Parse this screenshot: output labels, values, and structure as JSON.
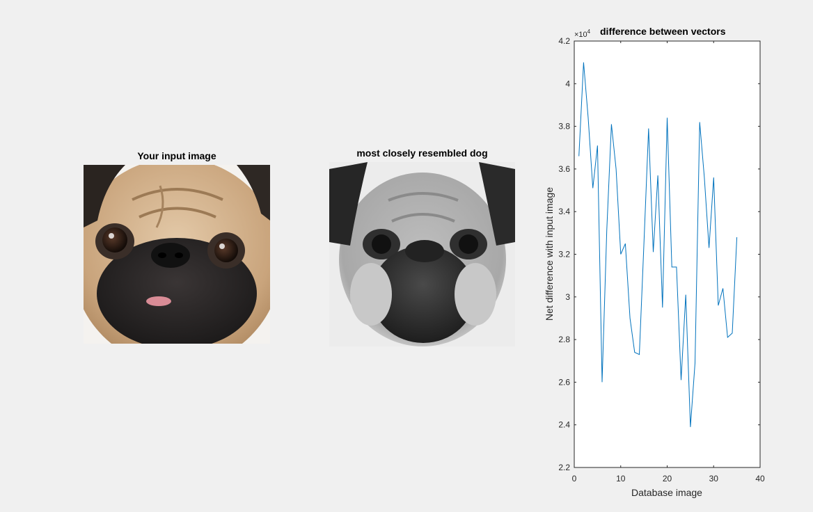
{
  "panels": {
    "input_title": "Your input image",
    "match_title": "most closely resembled dog"
  },
  "chart_data": {
    "type": "line",
    "title": "difference between vectors",
    "xlabel": "Database image",
    "ylabel": "Net difference with input image",
    "exponent_prefix": "×10",
    "exponent_power": "4",
    "xlim": [
      0,
      40
    ],
    "ylim": [
      2.2,
      4.2
    ],
    "y_multiplier": 10000,
    "xticks": [
      0,
      10,
      20,
      30,
      40
    ],
    "yticks": [
      2.2,
      2.4,
      2.6,
      2.8,
      3,
      3.2,
      3.4,
      3.6,
      3.8,
      4,
      4.2
    ],
    "ytick_labels": [
      "2.2",
      "2.4",
      "2.6",
      "2.8",
      "3",
      "3.2",
      "3.4",
      "3.6",
      "3.8",
      "4",
      "4.2"
    ],
    "grid": false,
    "series": [
      {
        "color": "#0072bd",
        "x": [
          1,
          2,
          3,
          4,
          5,
          6,
          7,
          8,
          9,
          10,
          11,
          12,
          13,
          14,
          15,
          16,
          17,
          18,
          19,
          20,
          21,
          22,
          23,
          24,
          25,
          26,
          27,
          28,
          29,
          30,
          31,
          32,
          33,
          34,
          35
        ],
        "y": [
          3.66,
          4.1,
          3.84,
          3.51,
          3.71,
          2.6,
          3.31,
          3.81,
          3.6,
          3.2,
          3.25,
          2.9,
          2.74,
          2.73,
          3.25,
          3.79,
          3.21,
          3.57,
          2.95,
          3.84,
          3.14,
          3.14,
          2.61,
          3.01,
          2.39,
          2.69,
          3.82,
          3.56,
          3.23,
          3.56,
          2.96,
          3.04,
          2.81,
          2.83,
          3.28
        ]
      }
    ]
  }
}
